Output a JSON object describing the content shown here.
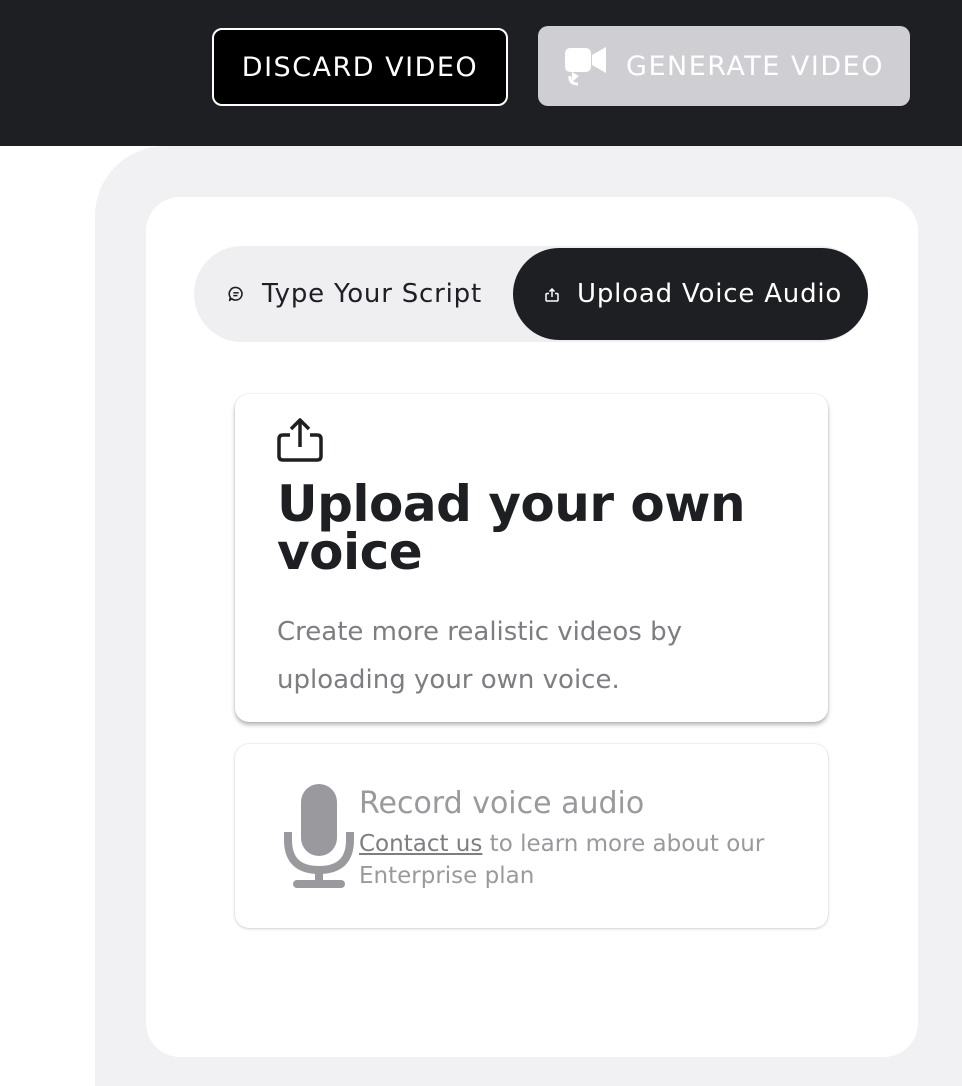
{
  "header": {
    "discard_label": "DISCARD VIDEO",
    "generate_label": "GENERATE VIDEO",
    "generate_icon": "video-camera-icon"
  },
  "tabs": [
    {
      "label": "Type Your Script",
      "icon": "chat-bubble-icon",
      "selected": false
    },
    {
      "label": "Upload Voice Audio",
      "icon": "upload-icon",
      "selected": true
    }
  ],
  "upload_card": {
    "icon": "upload-icon",
    "title": "Upload your own voice",
    "description": "Create more realistic videos by uploading your own voice."
  },
  "record_card": {
    "icon": "microphone-icon",
    "title": "Record voice audio",
    "link_text": "Contact us",
    "description_rest": " to learn more about our Enterprise plan",
    "disabled": true
  },
  "colors": {
    "topbar": "#1e1f22",
    "active_tab": "#1e1f22",
    "panel": "#f1f1f4",
    "generate_disabled": "#cfced2"
  }
}
